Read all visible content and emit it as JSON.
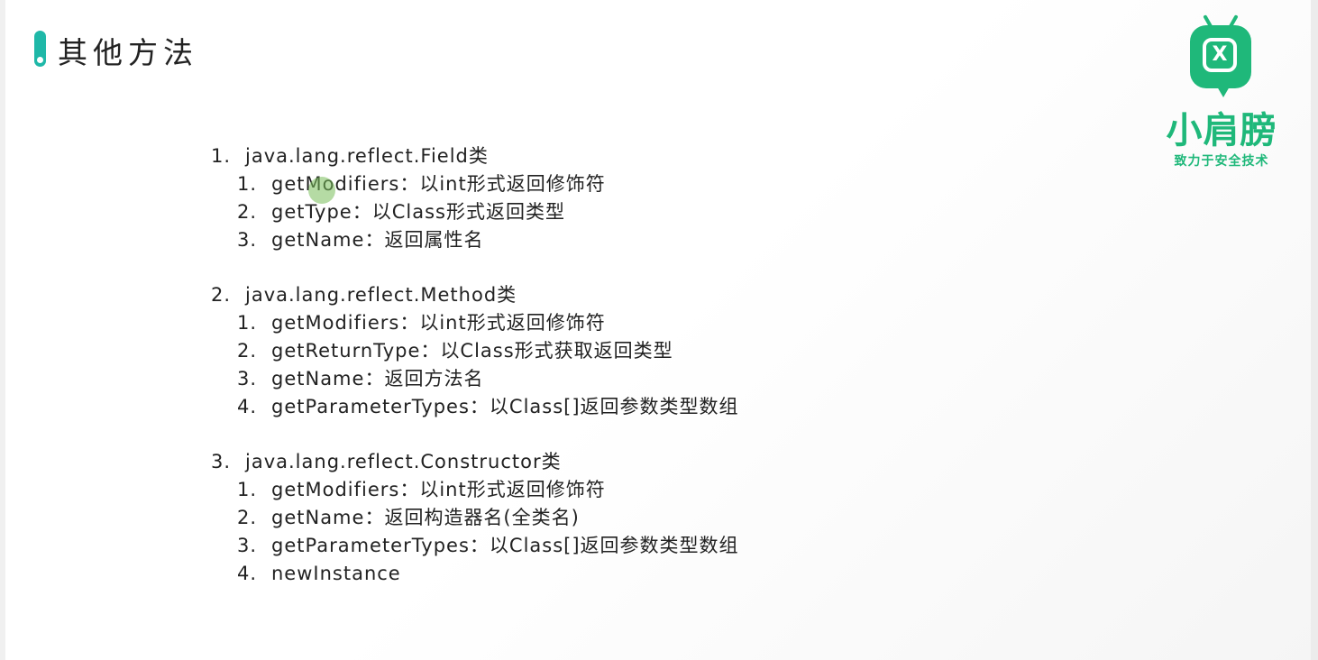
{
  "title": "其他方法",
  "logo": {
    "icon_letter": "X",
    "name": "小肩膀",
    "slogan": "致力于安全技术"
  },
  "sections": [
    {
      "num": "1.",
      "heading": "java.lang.reflect.Field类",
      "items": [
        {
          "num": "1.",
          "text": "getModifiers：以int形式返回修饰符"
        },
        {
          "num": "2.",
          "text": "getType：以Class形式返回类型"
        },
        {
          "num": "3.",
          "text": "getName：返回属性名"
        }
      ]
    },
    {
      "num": "2.",
      "heading": "java.lang.reflect.Method类",
      "items": [
        {
          "num": "1.",
          "text": "getModifiers：以int形式返回修饰符"
        },
        {
          "num": "2.",
          "text": "getReturnType：以Class形式获取返回类型"
        },
        {
          "num": "3.",
          "text": "getName：返回方法名"
        },
        {
          "num": "4.",
          "text": "getParameterTypes：以Class[]返回参数类型数组"
        }
      ]
    },
    {
      "num": "3.",
      "heading": "java.lang.reflect.Constructor类",
      "items": [
        {
          "num": "1.",
          "text": "getModifiers：以int形式返回修饰符"
        },
        {
          "num": "2.",
          "text": "getName：返回构造器名(全类名)"
        },
        {
          "num": "3.",
          "text": "getParameterTypes：以Class[]返回参数类型数组"
        },
        {
          "num": "4.",
          "text": "newInstance"
        }
      ]
    }
  ],
  "colors": {
    "accent": "#1fb8a8",
    "brand": "#1fb87a",
    "text": "#222222"
  }
}
